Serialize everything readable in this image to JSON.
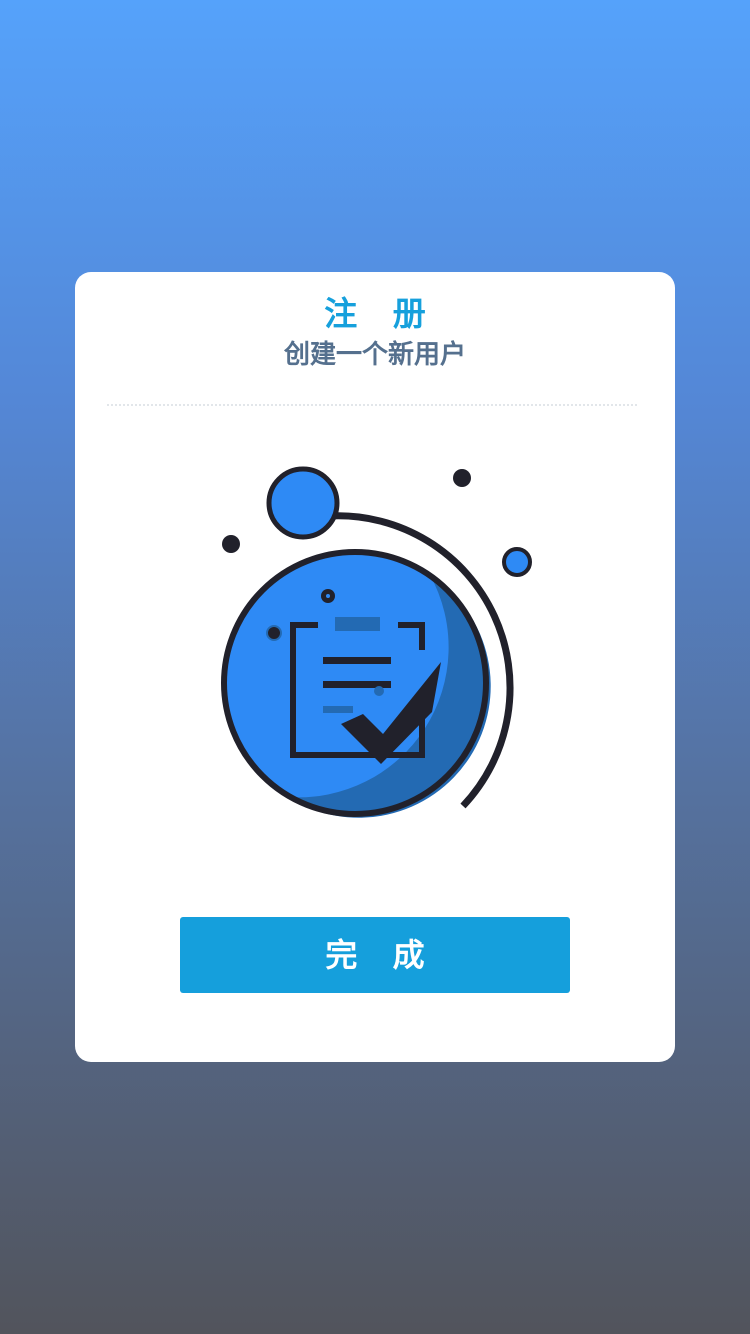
{
  "header": {
    "title": "注 册",
    "subtitle": "创建一个新用户"
  },
  "illustration": {
    "icon": "registration-clipboard-check-icon",
    "colors": {
      "fill": "#2e8af5",
      "shadow": "#236ab3",
      "outline": "#21212b"
    }
  },
  "actions": {
    "done_label": "完 成"
  },
  "colors": {
    "accent": "#159fdc",
    "title": "#16a0dc",
    "subtitle": "#55708e",
    "card": "#ffffff",
    "gradient_top": "#55a2fb",
    "gradient_bottom": "#52545c"
  }
}
